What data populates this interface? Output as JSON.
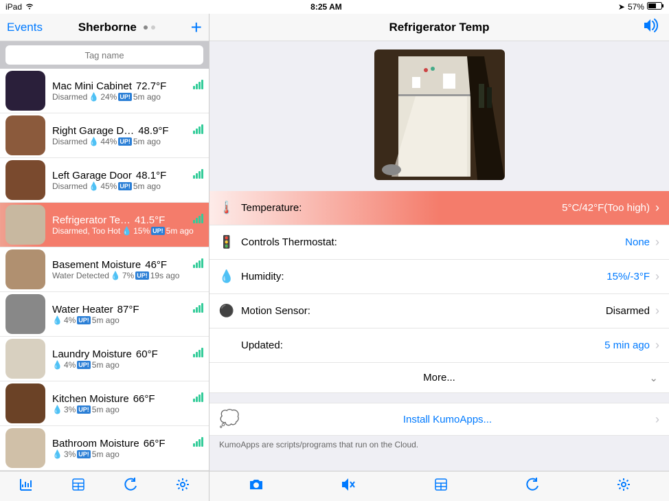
{
  "status": {
    "device": "iPad",
    "time": "8:25 AM",
    "battery": "57%"
  },
  "sidebar": {
    "events_link": "Events",
    "title": "Sherborne",
    "search_placeholder": "Tag name",
    "items": [
      {
        "name": "Mac Mini Cabinet",
        "temp": "72.7°F",
        "status": "Disarmed",
        "humidity": "24%",
        "age": "5m ago",
        "thumb_bg": "#2a1f3a"
      },
      {
        "name": "Right Garage D…",
        "temp": "48.9°F",
        "status": "Disarmed",
        "humidity": "44%",
        "age": "5m ago",
        "thumb_bg": "#8b5a3c"
      },
      {
        "name": "Left Garage Door",
        "temp": "48.1°F",
        "status": "Disarmed",
        "humidity": "45%",
        "age": "5m ago",
        "thumb_bg": "#7a4a2e"
      },
      {
        "name": "Refrigerator Te…",
        "temp": "41.5°F",
        "status": "Disarmed, Too Hot",
        "humidity": "15%",
        "age": "5m ago",
        "thumb_bg": "#c8b8a0",
        "selected": true
      },
      {
        "name": "Basement Moisture",
        "temp": "46°F",
        "status": "Water Detected",
        "humidity": "7%",
        "age": "19s ago",
        "thumb_bg": "#b09070"
      },
      {
        "name": "Water Heater",
        "temp": "87°F",
        "status": "",
        "humidity": "4%",
        "age": "5m ago",
        "thumb_bg": "#888"
      },
      {
        "name": "Laundry Moisture",
        "temp": "60°F",
        "status": "",
        "humidity": "4%",
        "age": "5m ago",
        "thumb_bg": "#d8d0c0"
      },
      {
        "name": "Kitchen Moisture",
        "temp": "66°F",
        "status": "",
        "humidity": "3%",
        "age": "5m ago",
        "thumb_bg": "#6b4226"
      },
      {
        "name": "Bathroom Moisture",
        "temp": "66°F",
        "status": "",
        "humidity": "3%",
        "age": "5m ago",
        "thumb_bg": "#d0c0a8"
      }
    ]
  },
  "detail": {
    "title": "Refrigerator Temp",
    "temperature": {
      "label": "Temperature:",
      "value": "5°C/42°F(Too high)"
    },
    "thermostat": {
      "label": "Controls Thermostat:",
      "value": "None"
    },
    "humidity": {
      "label": "Humidity:",
      "value": "15%/-3°F"
    },
    "motion": {
      "label": "Motion Sensor:",
      "value": "Disarmed"
    },
    "updated": {
      "label": "Updated:",
      "value": "5 min ago"
    },
    "more": "More...",
    "install": "Install KumoApps...",
    "hint": "KumoApps are scripts/programs that run on the Cloud."
  }
}
